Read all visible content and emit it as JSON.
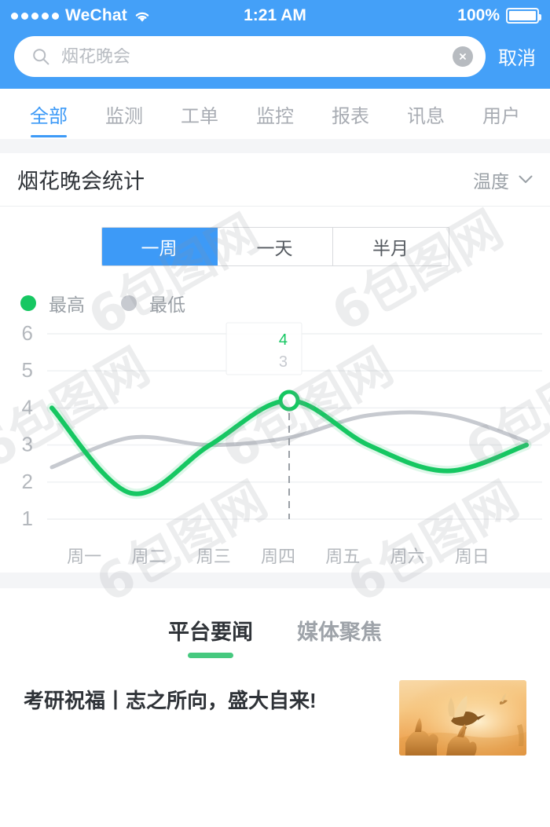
{
  "statusbar": {
    "carrier": "WeChat",
    "signal_dots": 5,
    "wifi_icon": "wifi-icon",
    "time": "1:21 AM",
    "battery_pct": "100%",
    "battery_icon": "battery-full-icon"
  },
  "search": {
    "icon": "search-icon",
    "value": "烟花晚会",
    "clear_icon": "clear-circle-icon",
    "cancel_label": "取消"
  },
  "category_tabs": [
    {
      "label": "全部",
      "active": true
    },
    {
      "label": "监测",
      "active": false
    },
    {
      "label": "工单",
      "active": false
    },
    {
      "label": "监控",
      "active": false
    },
    {
      "label": "报表",
      "active": false
    },
    {
      "label": "讯息",
      "active": false
    },
    {
      "label": "用户",
      "active": false
    }
  ],
  "chart_card": {
    "title": "烟花晚会统计",
    "metric_select": {
      "label": "温度",
      "icon": "chevron-down-icon"
    },
    "range_segments": [
      {
        "label": "一周",
        "active": true
      },
      {
        "label": "一天",
        "active": false
      },
      {
        "label": "半月",
        "active": false
      }
    ]
  },
  "news": {
    "tabs": [
      {
        "label": "平台要闻",
        "active": true
      },
      {
        "label": "媒体聚焦",
        "active": false
      }
    ],
    "items": [
      {
        "title": "考研祝福丨志之所向，盛大自来!",
        "thumb": "sunset-hands-doves-image"
      }
    ]
  },
  "watermark": {
    "text": "6包图网"
  },
  "chart_data": {
    "type": "line",
    "title": "烟花晚会统计",
    "xlabel": "",
    "ylabel": "",
    "categories": [
      "周一",
      "周二",
      "周三",
      "周四",
      "周五",
      "周六",
      "周日"
    ],
    "ylim": [
      1,
      6
    ],
    "yticks": [
      1,
      2,
      3,
      4,
      5,
      6
    ],
    "grid": true,
    "legend_position": "top-left",
    "series": [
      {
        "name": "最高",
        "color": "#16c762",
        "values": [
          4.0,
          1.7,
          3.0,
          4.2,
          3.0,
          2.3,
          3.0
        ]
      },
      {
        "name": "最低",
        "color": "#c7cad0",
        "values": [
          2.4,
          3.2,
          3.0,
          3.2,
          3.8,
          3.8,
          3.1
        ]
      }
    ],
    "highlight": {
      "category": "周四",
      "series": "最高",
      "value": 4.2,
      "marker": "hollow-circle",
      "guideline": "dashed-vertical"
    },
    "tooltip": {
      "high_value": "4",
      "low_value": "3",
      "high_color": "#16c762",
      "low_color": "#c7cad0"
    }
  }
}
